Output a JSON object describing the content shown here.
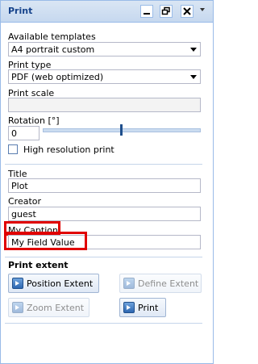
{
  "panel": {
    "title": "Print",
    "tools": [
      "minimize-icon",
      "restore-icon",
      "close-icon",
      "menu-dropdown-icon"
    ]
  },
  "form": {
    "templates_label": "Available templates",
    "templates_value": "A4 portrait custom",
    "print_type_label": "Print type",
    "print_type_value": "PDF (web optimized)",
    "print_scale_label": "Print scale",
    "print_scale_value": "",
    "rotation_label": "Rotation [°]",
    "rotation_value": "0",
    "high_res_label": "High resolution print",
    "high_res_checked": false,
    "title_label": "Title",
    "title_value": "Plot",
    "creator_label": "Creator",
    "creator_value": "guest",
    "caption_label": "My Caption",
    "caption_value": "My Field Value"
  },
  "extent": {
    "heading": "Print extent",
    "position_extent": "Position Extent",
    "define_extent": "Define Extent",
    "zoom_extent": "Zoom Extent",
    "print": "Print"
  },
  "colors": {
    "highlight": "#e00000",
    "accent": "#15428b"
  }
}
